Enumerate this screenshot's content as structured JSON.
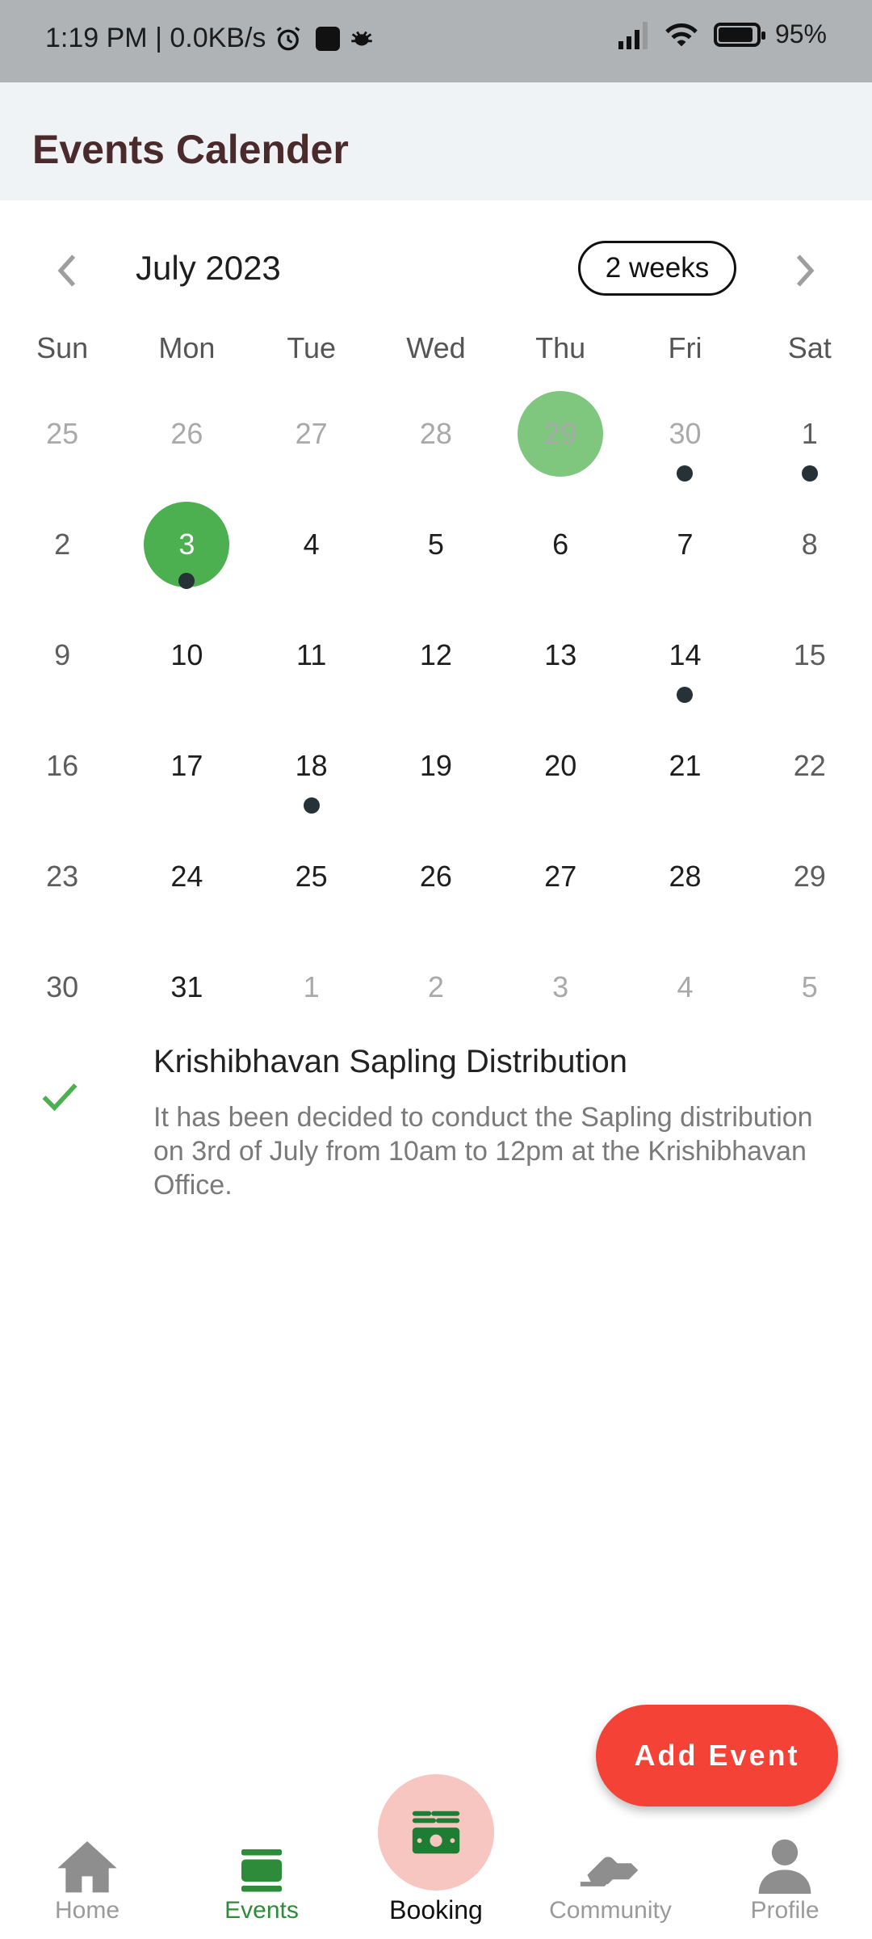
{
  "status_bar": {
    "time_speed": "1:19 PM | 0.0KB/s",
    "battery": "95%"
  },
  "app_bar": {
    "title": "Events Calender"
  },
  "calendar": {
    "month_title": "July 2023",
    "format_button": "2 weeks",
    "weekdays": [
      "Sun",
      "Mon",
      "Tue",
      "Wed",
      "Thu",
      "Fri",
      "Sat"
    ],
    "days": [
      {
        "d": "25",
        "outside": true
      },
      {
        "d": "26",
        "outside": true
      },
      {
        "d": "27",
        "outside": true
      },
      {
        "d": "28",
        "outside": true
      },
      {
        "d": "29",
        "outside": true,
        "today": true
      },
      {
        "d": "30",
        "outside": true,
        "event": true
      },
      {
        "d": "1",
        "weekend": true,
        "event": true
      },
      {
        "d": "2",
        "weekend": true
      },
      {
        "d": "3",
        "selected": true,
        "event": true
      },
      {
        "d": "4"
      },
      {
        "d": "5"
      },
      {
        "d": "6"
      },
      {
        "d": "7"
      },
      {
        "d": "8",
        "weekend": true
      },
      {
        "d": "9",
        "weekend": true
      },
      {
        "d": "10"
      },
      {
        "d": "11"
      },
      {
        "d": "12"
      },
      {
        "d": "13"
      },
      {
        "d": "14",
        "event": true
      },
      {
        "d": "15",
        "weekend": true
      },
      {
        "d": "16",
        "weekend": true
      },
      {
        "d": "17"
      },
      {
        "d": "18",
        "event": true
      },
      {
        "d": "19"
      },
      {
        "d": "20"
      },
      {
        "d": "21"
      },
      {
        "d": "22",
        "weekend": true
      },
      {
        "d": "23",
        "weekend": true
      },
      {
        "d": "24"
      },
      {
        "d": "25"
      },
      {
        "d": "26"
      },
      {
        "d": "27"
      },
      {
        "d": "28"
      },
      {
        "d": "29",
        "weekend": true
      },
      {
        "d": "30",
        "weekend": true
      },
      {
        "d": "31"
      },
      {
        "d": "1",
        "outside": true
      },
      {
        "d": "2",
        "outside": true
      },
      {
        "d": "3",
        "outside": true
      },
      {
        "d": "4",
        "outside": true
      },
      {
        "d": "5",
        "outside": true
      }
    ],
    "colors": {
      "today": "#7fc67f",
      "selected": "#4caf50",
      "marker": "#263238"
    }
  },
  "event": {
    "title": "Krishibhavan Sapling Distribution",
    "description": "It has been decided to conduct the Sapling distribution on 3rd of July from 10am to 12pm at the Krishibhavan Office."
  },
  "fab": {
    "label": "Add Event",
    "color": "#f44336"
  },
  "bottom_nav": {
    "home": "Home",
    "events": "Events",
    "booking": "Booking",
    "community": "Community",
    "profile": "Profile"
  }
}
